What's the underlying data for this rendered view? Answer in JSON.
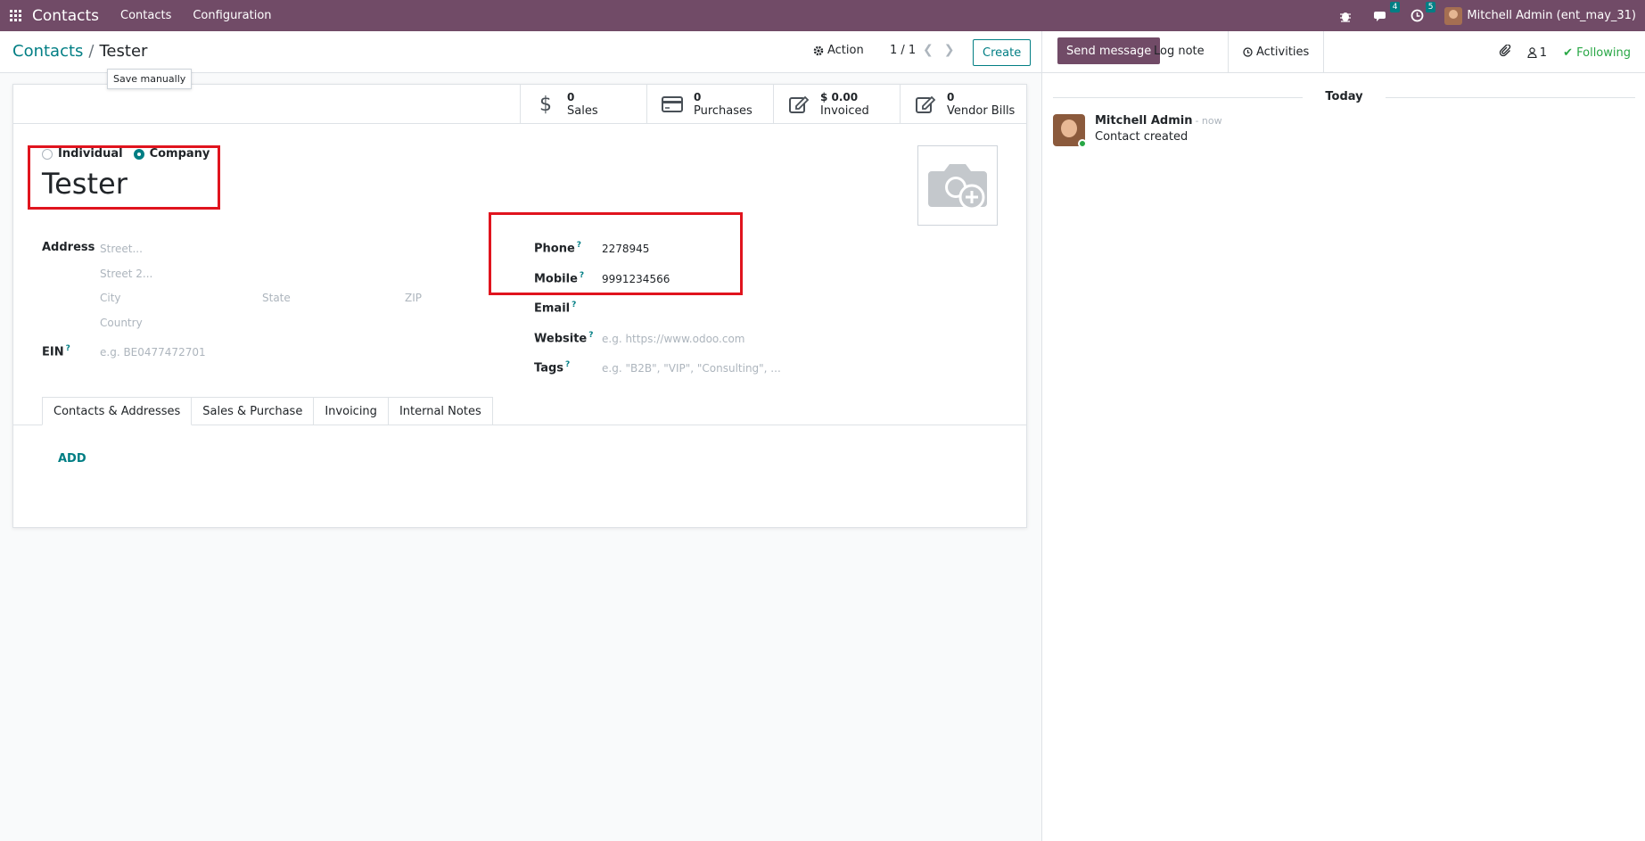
{
  "navbar": {
    "app_name": "Contacts",
    "menus": [
      "Contacts",
      "Configuration"
    ],
    "messages_count": "4",
    "activities_count": "5",
    "user": "Mitchell Admin (ent_may_31)"
  },
  "control": {
    "breadcrumb_parent": "Contacts",
    "breadcrumb_sep": "/",
    "breadcrumb_current": "Tester",
    "tooltip": "Save manually",
    "action_label": "Action",
    "pager": "1 / 1",
    "create_label": "Create"
  },
  "stats": [
    {
      "value": "0",
      "label": "Sales",
      "icon": "dollar-icon"
    },
    {
      "value": "0",
      "label": "Purchases",
      "icon": "credit-card-icon"
    },
    {
      "value": "$ 0.00",
      "label": "Invoiced",
      "icon": "edit-icon"
    },
    {
      "value": "0",
      "label": "Vendor Bills",
      "icon": "edit-icon"
    }
  ],
  "form": {
    "type_individual": "Individual",
    "type_company": "Company",
    "selected_type": "Company",
    "name": "Tester",
    "address_label": "Address",
    "street_ph": "Street...",
    "street2_ph": "Street 2...",
    "city_ph": "City",
    "state_ph": "State",
    "zip_ph": "ZIP",
    "country_ph": "Country",
    "ein_label": "EIN",
    "ein_ph": "e.g. BE0477472701",
    "phone_label": "Phone",
    "phone": "2278945",
    "mobile_label": "Mobile",
    "mobile": "9991234566",
    "email_label": "Email",
    "website_label": "Website",
    "website_ph": "e.g. https://www.odoo.com",
    "tags_label": "Tags",
    "tags_ph": "e.g. \"B2B\", \"VIP\", \"Consulting\", ...",
    "help_mark": "?"
  },
  "tabs": [
    "Contacts & Addresses",
    "Sales & Purchase",
    "Invoicing",
    "Internal Notes"
  ],
  "add_label": "ADD",
  "chatter": {
    "send_message": "Send message",
    "log_note": "Log note",
    "activities": "Activities",
    "followers_count": "1",
    "following": "Following",
    "today": "Today",
    "message": {
      "author": "Mitchell Admin",
      "date": "- now",
      "body": "Contact created"
    }
  },
  "colors": {
    "brand": "#714b67",
    "accent": "#017e84",
    "highlight": "#e0141e"
  }
}
